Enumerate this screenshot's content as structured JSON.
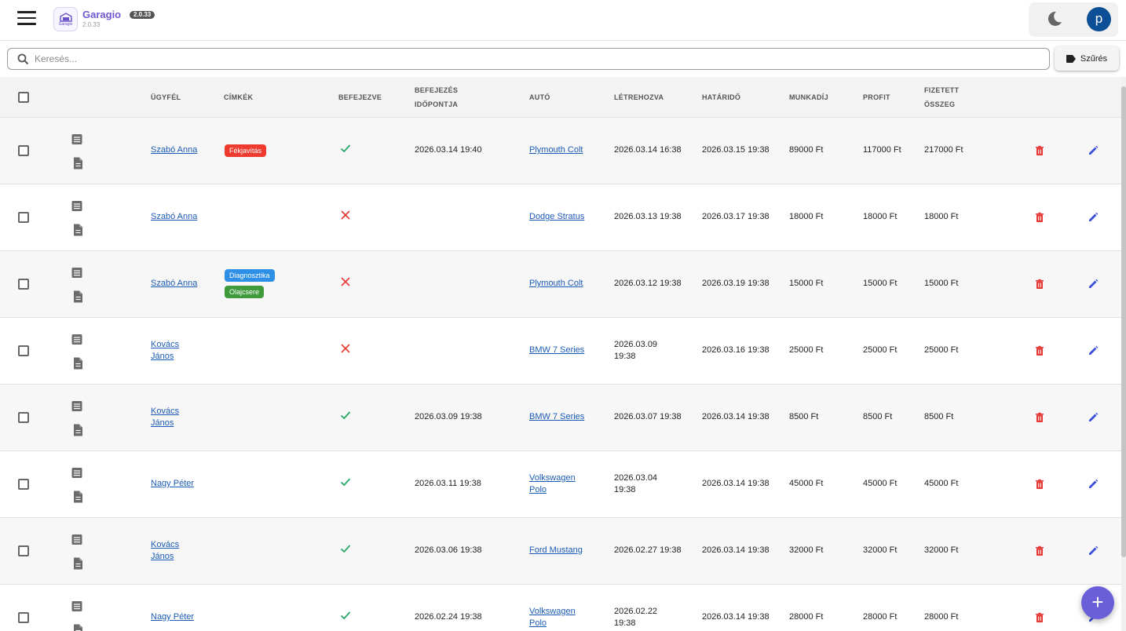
{
  "app": {
    "name": "Garagio",
    "version": "2.0.33",
    "version_badge": "2.0.33",
    "logo_text": "Garagio",
    "brand_color": "#7058d0",
    "avatar_letter": "p"
  },
  "search": {
    "placeholder": "Keresés...",
    "value": ""
  },
  "filter": {
    "label": "Szűrés"
  },
  "table": {
    "headers": {
      "client": "ÜGYFÉL",
      "tags": "CÍMKÉK",
      "finished": "BEFEJEZVE",
      "finished_at_1": "BEFEJEZÉS",
      "finished_at_2": "IDŐPONTJA",
      "car": "AUTÓ",
      "created": "LÉTREHOZVA",
      "deadline": "HATÁRIDŐ",
      "labor_fee": "MUNKADÍJ",
      "profit": "PROFIT",
      "paid_1": "FIZETETT",
      "paid_2": "ÖSSZEG"
    },
    "tag_colors": {
      "Fékjavítás": "#ef3b2f",
      "Diagnosztika": "#2e8fe6",
      "Olajcsere": "#3e9a3a"
    },
    "rows": [
      {
        "client_1": "Szabó Anna",
        "client_2": "",
        "tags": [
          "Fékjavítás"
        ],
        "finished": true,
        "finished_at": "2026.03.14 19:40",
        "car_1": "Plymouth Colt",
        "car_2": "",
        "created_1": "2026.03.14 16:38",
        "created_2": "",
        "deadline": "2026.03.15 19:38",
        "labor_fee": "89000 Ft",
        "profit": "117000 Ft",
        "paid": "217000 Ft"
      },
      {
        "client_1": "Szabó Anna",
        "client_2": "",
        "tags": [],
        "finished": false,
        "finished_at": "",
        "car_1": "Dodge Stratus",
        "car_2": "",
        "created_1": "2026.03.13 19:38",
        "created_2": "",
        "deadline": "2026.03.17 19:38",
        "labor_fee": "18000 Ft",
        "profit": "18000 Ft",
        "paid": "18000 Ft"
      },
      {
        "client_1": "Szabó Anna",
        "client_2": "",
        "tags": [
          "Diagnosztika",
          "Olajcsere"
        ],
        "finished": false,
        "finished_at": "",
        "car_1": "Plymouth Colt",
        "car_2": "",
        "created_1": "2026.03.12 19:38",
        "created_2": "",
        "deadline": "2026.03.19 19:38",
        "labor_fee": "15000 Ft",
        "profit": "15000 Ft",
        "paid": "15000 Ft"
      },
      {
        "client_1": "Kovács",
        "client_2": "János",
        "tags": [],
        "finished": false,
        "finished_at": "",
        "car_1": "BMW 7 Series",
        "car_2": "",
        "created_1": "2026.03.09",
        "created_2": "19:38",
        "deadline": "2026.03.16 19:38",
        "labor_fee": "25000 Ft",
        "profit": "25000 Ft",
        "paid": "25000 Ft"
      },
      {
        "client_1": "Kovács",
        "client_2": "János",
        "tags": [],
        "finished": true,
        "finished_at": "2026.03.09 19:38",
        "car_1": "BMW 7 Series",
        "car_2": "",
        "created_1": "2026.03.07 19:38",
        "created_2": "",
        "deadline": "2026.03.14 19:38",
        "labor_fee": "8500 Ft",
        "profit": "8500 Ft",
        "paid": "8500 Ft"
      },
      {
        "client_1": "Nagy Péter",
        "client_2": "",
        "tags": [],
        "finished": true,
        "finished_at": "2026.03.11 19:38",
        "car_1": "Volkswagen",
        "car_2": "Polo",
        "created_1": "2026.03.04",
        "created_2": "19:38",
        "deadline": "2026.03.14 19:38",
        "labor_fee": "45000 Ft",
        "profit": "45000 Ft",
        "paid": "45000 Ft"
      },
      {
        "client_1": "Kovács",
        "client_2": "János",
        "tags": [],
        "finished": true,
        "finished_at": "2026.03.06 19:38",
        "car_1": "Ford Mustang",
        "car_2": "",
        "created_1": "2026.02.27 19:38",
        "created_2": "",
        "deadline": "2026.03.14 19:38",
        "labor_fee": "32000 Ft",
        "profit": "32000 Ft",
        "paid": "32000 Ft"
      },
      {
        "client_1": "Nagy Péter",
        "client_2": "",
        "tags": [],
        "finished": true,
        "finished_at": "2026.02.24 19:38",
        "car_1": "Volkswagen",
        "car_2": "Polo",
        "created_1": "2026.02.22",
        "created_2": "19:38",
        "deadline": "2026.03.14 19:38",
        "labor_fee": "28000 Ft",
        "profit": "28000 Ft",
        "paid": "28000 Ft"
      }
    ]
  }
}
